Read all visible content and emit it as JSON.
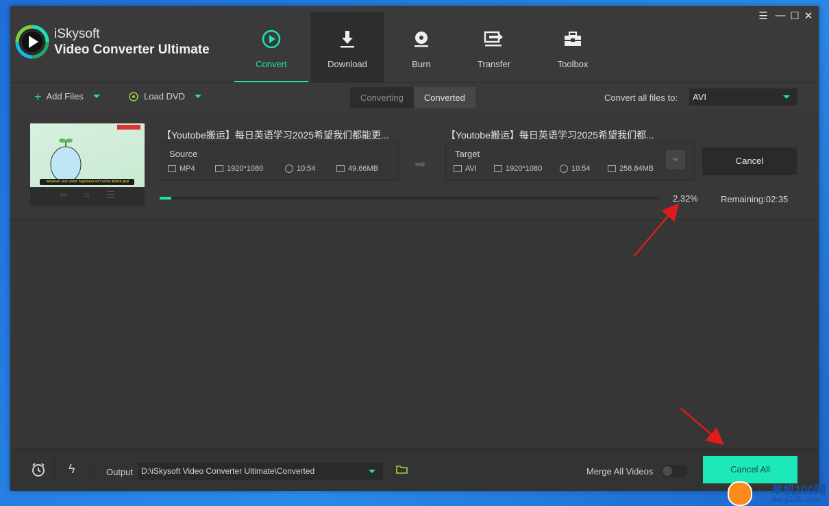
{
  "app": {
    "brand_line1": "iSkysoft",
    "brand_line2": "Video Converter Ultimate",
    "accent_color": "#1de3b2"
  },
  "window_controls": {
    "menu": "☰",
    "minimize": "—",
    "maximize": "☐",
    "close": "✕"
  },
  "nav": [
    {
      "label": "Convert",
      "icon": "convert-icon"
    },
    {
      "label": "Download",
      "icon": "download-icon"
    },
    {
      "label": "Burn",
      "icon": "burn-icon"
    },
    {
      "label": "Transfer",
      "icon": "transfer-icon"
    },
    {
      "label": "Toolbox",
      "icon": "toolbox-icon"
    }
  ],
  "toolbar": {
    "add_files": "Add Files",
    "load_dvd": "Load DVD",
    "tab_converting": "Converting",
    "tab_converted": "Converted",
    "convert_all_label": "Convert all files to:",
    "convert_all_value": "AVI"
  },
  "item": {
    "thumb_caption": "whatever your vision happiness isn't some distant goal",
    "source_title": "【Youtobe搬运】每日英语学习2025希望我们都能更...",
    "target_title": "【Youtobe搬运】每日英语学习2025希望我们都...",
    "source": {
      "heading": "Source",
      "format": "MP4",
      "resolution": "1920*1080",
      "duration": "10:54",
      "size": "49.66MB"
    },
    "target": {
      "heading": "Target",
      "format": "AVI",
      "resolution": "1920*1080",
      "duration": "10:54",
      "size": "258.84MB"
    },
    "cancel_label": "Cancel",
    "progress_percent": 2.32,
    "progress_text": "2.32%",
    "remaining_text": "Remaining:02:35"
  },
  "bottom": {
    "output_label": "Output",
    "output_path": "D:\\iSkysoft Video Converter Ultimate\\Converted",
    "merge_label": "Merge All Videos",
    "merge_enabled": false,
    "cancel_all_label": "Cancel All"
  },
  "watermark": {
    "line1": "单机100网",
    "line2": "danji100.com"
  }
}
